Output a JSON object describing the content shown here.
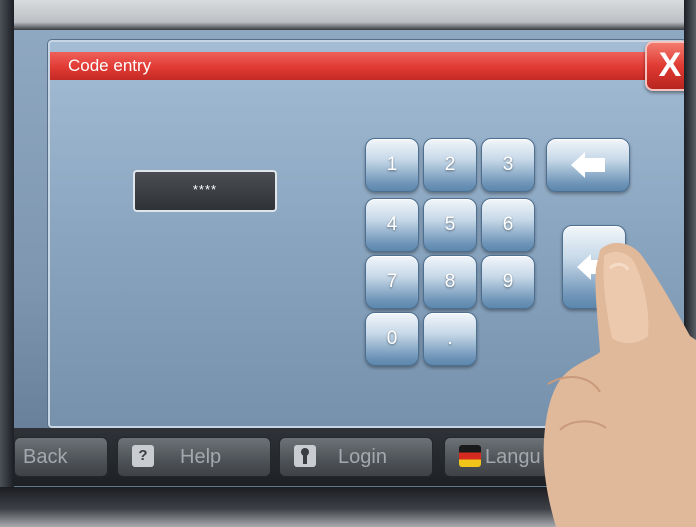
{
  "dialog": {
    "title": "Code entry",
    "close_label": "X"
  },
  "code_field": {
    "value": "****"
  },
  "keypad": {
    "keys": [
      "1",
      "2",
      "3",
      "4",
      "5",
      "6",
      "7",
      "8",
      "9",
      "0",
      "."
    ],
    "backspace_icon": "arrow-left-icon",
    "enter_icon": "arrow-left-icon"
  },
  "taskbar": {
    "back_label": "Back",
    "help_label": "Help",
    "help_icon_glyph": "?",
    "login_label": "Login",
    "language_label": "Langu"
  },
  "colors": {
    "title_bar": "#e03a34",
    "dialog_bg": "#8aa5c0",
    "key_face": "#6f95b8"
  }
}
